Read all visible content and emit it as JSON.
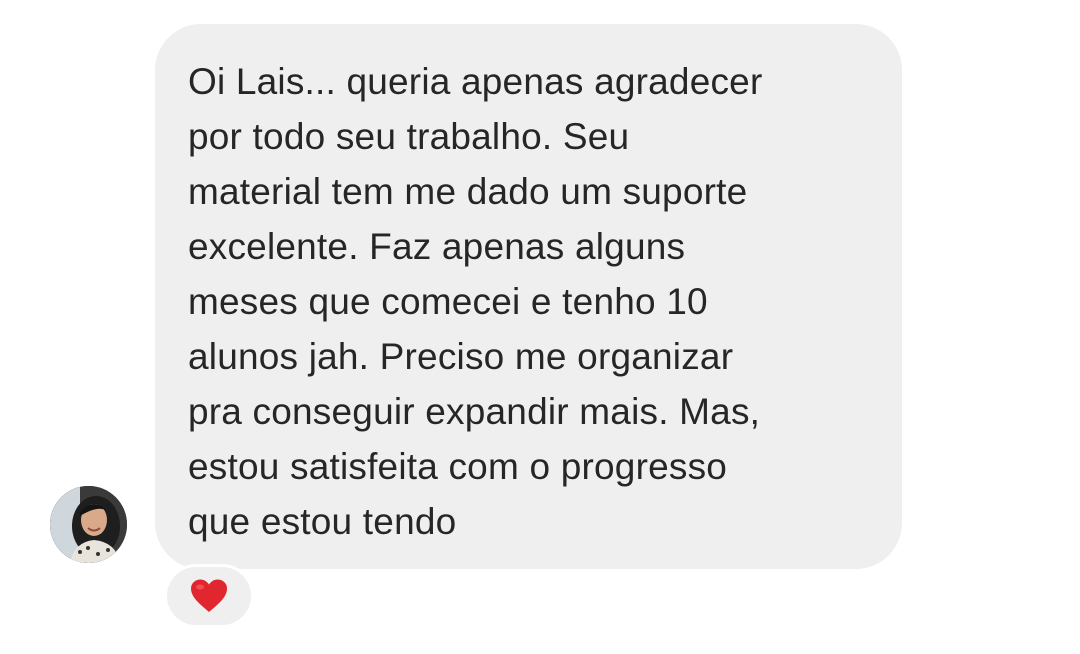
{
  "message": {
    "lines": [
      "Oi Lais... queria apenas agradecer",
      "por todo seu trabalho. Seu",
      "material tem me dado um suporte",
      "excelente. Faz apenas alguns",
      "meses que comecei e tenho 10",
      "alunos jah. Preciso me organizar",
      "pra conseguir expandir mais. Mas,",
      "estou satisfeita com o progresso",
      "que estou tendo"
    ]
  },
  "reaction": {
    "emoji": "heart-icon",
    "color": "#e0262e"
  },
  "colors": {
    "bubble": "#efefef",
    "text": "#262626",
    "background": "#ffffff"
  }
}
